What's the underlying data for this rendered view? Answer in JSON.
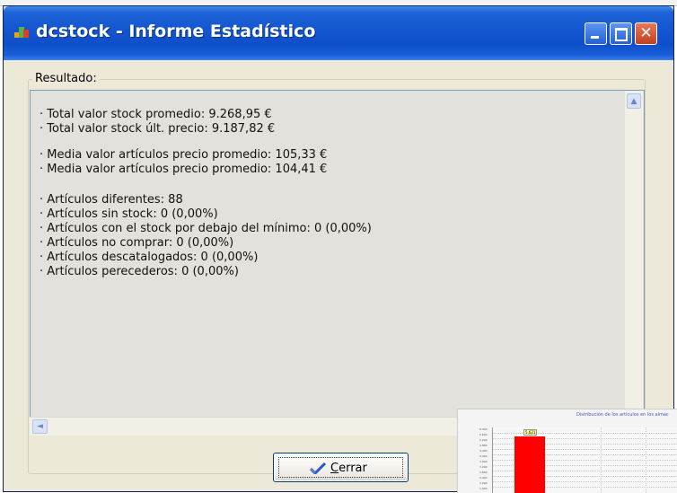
{
  "window": {
    "title": "dcstock - Informe Estadístico",
    "close_glyph": "✕"
  },
  "group": {
    "legend": "Resultado:"
  },
  "result_lines": [
    "· Total valor stock promedio: 9.268,95 €",
    "· Total valor stock últ. precio: 9.187,82 €",
    "· Media valor artículos precio promedio: 105,33 €",
    "· Media valor artículos precio promedio: 104,41 €",
    "· Artículos diferentes: 88",
    "· Artículos sin stock: 0 (0,00%)",
    "· Artículos con el stock por debajo del mínimo: 0 (0,00%)",
    "· Artículos no comprar: 0 (0,00%)",
    "· Artículos descatalogados: 0 (0,00%)",
    "· Artículos perecederos: 0 (0,00%)"
  ],
  "scroll": {
    "up_glyph": "▲",
    "left_glyph": "◄"
  },
  "buttons": {
    "close_prefix": "",
    "close_mnemonic": "C",
    "close_rest": "errar"
  },
  "chart_preview": {
    "title": "Distribución de los artículos en los almac",
    "bar_label": "5.621"
  },
  "colors": {
    "titlebar": "#1457d0",
    "window_bg": "#ece9d8",
    "textarea_bg": "#e2e1dc",
    "bar": "#ff0000"
  }
}
